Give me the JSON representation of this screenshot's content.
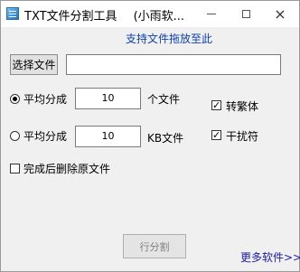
{
  "window": {
    "title": "TXT文件分割工具",
    "title_suffix": "(小雨软...",
    "close_glyph": "×"
  },
  "drag_hint": "支持文件拖放至此",
  "select_file": {
    "label": "选择文件",
    "path_value": ""
  },
  "options": {
    "split_by_count": {
      "label": "平均分成",
      "value": "10",
      "unit": "个文件",
      "selected": true
    },
    "split_by_size": {
      "label": "平均分成",
      "value": "10",
      "unit": "KB文件",
      "selected": false
    },
    "traditional": {
      "label": "转繁体",
      "checked": true,
      "mark": "✓"
    },
    "interference": {
      "label": "干扰符",
      "checked": true,
      "mark": "✓"
    },
    "delete_original": {
      "label": "完成后删除原文件",
      "checked": false,
      "mark": ""
    }
  },
  "split_button": {
    "label": "行分割"
  },
  "more_software": "更多软件>>"
}
